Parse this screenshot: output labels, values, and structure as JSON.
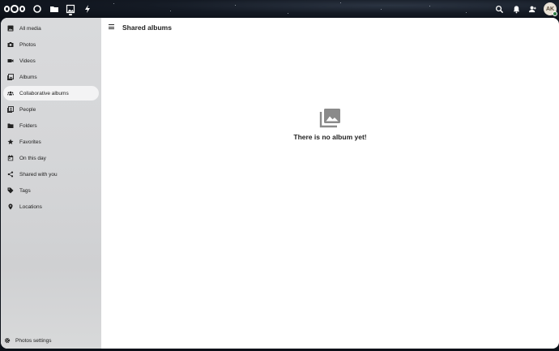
{
  "header": {
    "apps": [
      {
        "name": "dashboard-icon"
      },
      {
        "name": "files-icon"
      },
      {
        "name": "photos-icon",
        "active": true
      },
      {
        "name": "activity-icon"
      }
    ],
    "user_initials": "AK"
  },
  "sidebar": {
    "items": [
      {
        "label": "All media",
        "icon": "image-icon"
      },
      {
        "label": "Photos",
        "icon": "camera-icon"
      },
      {
        "label": "Videos",
        "icon": "video-icon"
      },
      {
        "label": "Albums",
        "icon": "albums-icon"
      },
      {
        "label": "Collaborative albums",
        "icon": "group-icon",
        "active": true
      },
      {
        "label": "People",
        "icon": "people-icon"
      },
      {
        "label": "Folders",
        "icon": "folder-icon"
      },
      {
        "label": "Favorites",
        "icon": "star-icon"
      },
      {
        "label": "On this day",
        "icon": "calendar-icon"
      },
      {
        "label": "Shared with you",
        "icon": "share-icon"
      },
      {
        "label": "Tags",
        "icon": "tag-icon"
      },
      {
        "label": "Locations",
        "icon": "map-marker-icon"
      }
    ],
    "settings_label": "Photos settings"
  },
  "main": {
    "title": "Shared albums",
    "empty_message": "There is no album yet!"
  },
  "colors": {
    "sidebar_bg": "#d4d5d7",
    "active_item_bg": "#f3f3f4",
    "empty_icon": "#8a8a8a",
    "status_online": "#2d7b41"
  }
}
